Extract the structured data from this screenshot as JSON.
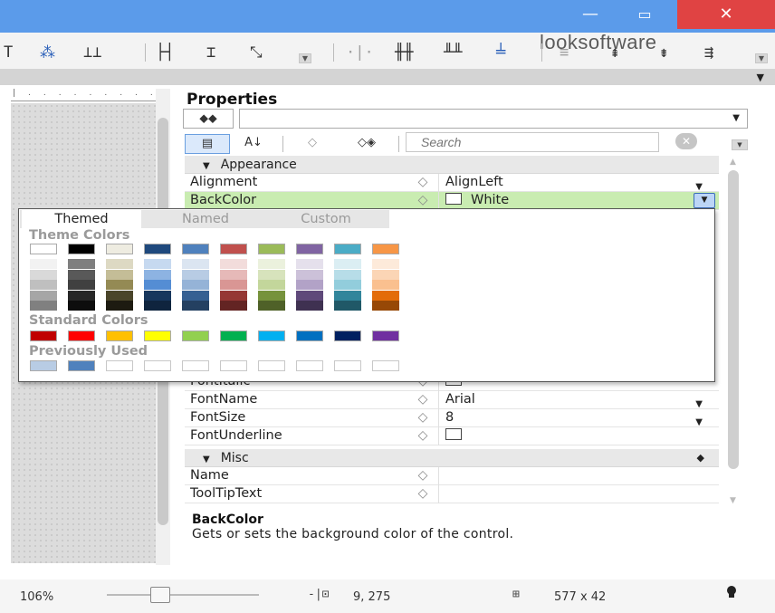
{
  "window": {
    "minimize_glyph": "—",
    "maximize_glyph": "▭",
    "close_glyph": "✕"
  },
  "toolbar": {
    "brand": "looksoftware",
    "tools": [
      {
        "name": "align-top-icon",
        "glyph": "T"
      },
      {
        "name": "align-middle-icon",
        "glyph": "⁂"
      },
      {
        "name": "align-bottom-icon",
        "glyph": "⊥⊥"
      },
      {
        "name": "same-width-icon",
        "glyph": "├┤"
      },
      {
        "name": "same-height-icon",
        "glyph": "⌶"
      },
      {
        "name": "same-size-icon",
        "glyph": "⤡"
      },
      {
        "name": "h-spacing-icon",
        "glyph": "·|·"
      },
      {
        "name": "h-spacing-equal-icon",
        "glyph": "╫╫"
      },
      {
        "name": "h-spacing-inc-icon",
        "glyph": "╨╨"
      },
      {
        "name": "h-spacing-dec-icon",
        "glyph": "╧"
      },
      {
        "name": "v-spacing-icon",
        "glyph": "≡"
      },
      {
        "name": "v-spacing-equal-icon",
        "glyph": "⇞"
      },
      {
        "name": "v-spacing-inc-icon",
        "glyph": "⇟"
      },
      {
        "name": "v-spacing-dec-icon",
        "glyph": "⇶"
      }
    ]
  },
  "properties": {
    "title": "Properties",
    "object_icon": "⬥⬥",
    "object_value": "",
    "categorized_icon": "▤",
    "alphabetical_icon": "A↓",
    "events_icon": "◇",
    "bind_icon": "◇◈",
    "search_placeholder": "Search",
    "search_clear": "✕",
    "categories": {
      "appearance": "Appearance",
      "misc": "Misc"
    },
    "rows_top": [
      {
        "name": "Alignment",
        "value": "AlignLeft",
        "type": "dropdown"
      },
      {
        "name": "BackColor",
        "value": "White",
        "type": "color"
      }
    ],
    "rows_font": [
      {
        "name": "FontItalic",
        "value": "",
        "type": "check"
      },
      {
        "name": "FontName",
        "value": "Arial",
        "type": "dropdown"
      },
      {
        "name": "FontSize",
        "value": "8",
        "type": "dropdown"
      },
      {
        "name": "FontUnderline",
        "value": "",
        "type": "check"
      }
    ],
    "rows_misc": [
      {
        "name": "Name",
        "value": ""
      },
      {
        "name": "ToolTipText",
        "value": ""
      }
    ],
    "description": {
      "title": "BackColor",
      "text": "Gets or sets the background color of the control."
    }
  },
  "color_popup": {
    "tabs": [
      "Themed",
      "Named",
      "Custom"
    ],
    "active_tab": "Themed",
    "theme_title": "Theme Colors",
    "standard_title": "Standard Colors",
    "previous_title": "Previously Used",
    "theme_columns": [
      {
        "base": "#ffffff",
        "shades": [
          "#f2f2f2",
          "#d9d9d9",
          "#bfbfbf",
          "#a6a6a6",
          "#808080"
        ]
      },
      {
        "base": "#000000",
        "shades": [
          "#7f7f7f",
          "#595959",
          "#404040",
          "#262626",
          "#0d0d0d"
        ]
      },
      {
        "base": "#eeece1",
        "shades": [
          "#ddd9c3",
          "#c4bd97",
          "#948a54",
          "#4a452a",
          "#1d1b11"
        ]
      },
      {
        "base": "#1f497d",
        "shades": [
          "#c6d9f0",
          "#8db3e2",
          "#548dd4",
          "#17365d",
          "#0f243e"
        ]
      },
      {
        "base": "#4f81bd",
        "shades": [
          "#dbe5f1",
          "#b8cce4",
          "#95b3d7",
          "#366092",
          "#244061"
        ]
      },
      {
        "base": "#c0504d",
        "shades": [
          "#f2dcdb",
          "#e6b9b8",
          "#d99694",
          "#953734",
          "#632423"
        ]
      },
      {
        "base": "#9bbb59",
        "shades": [
          "#ebf1dd",
          "#d7e3bc",
          "#c3d69b",
          "#76923c",
          "#4f6128"
        ]
      },
      {
        "base": "#8064a2",
        "shades": [
          "#e5e0ec",
          "#ccc1d9",
          "#b2a2c7",
          "#5f497a",
          "#3f3151"
        ]
      },
      {
        "base": "#4bacc6",
        "shades": [
          "#dbeef3",
          "#b7dde8",
          "#92cddc",
          "#31859b",
          "#205867"
        ]
      },
      {
        "base": "#f79646",
        "shades": [
          "#fdeada",
          "#fbd5b5",
          "#fac08f",
          "#e36c09",
          "#974806"
        ]
      }
    ],
    "standard_colors": [
      "#c00000",
      "#ff0000",
      "#ffc000",
      "#ffff00",
      "#92d050",
      "#00b050",
      "#00b0f0",
      "#0070c0",
      "#002060",
      "#7030a0"
    ],
    "previous_colors": [
      "#b8cce4",
      "#4f81bd",
      "",
      "",
      "",
      "",
      "",
      "",
      "",
      ""
    ]
  },
  "status": {
    "zoom": "106%",
    "zoom_fraction": 0.35,
    "position": "9, 275",
    "size": "577 x 42"
  }
}
